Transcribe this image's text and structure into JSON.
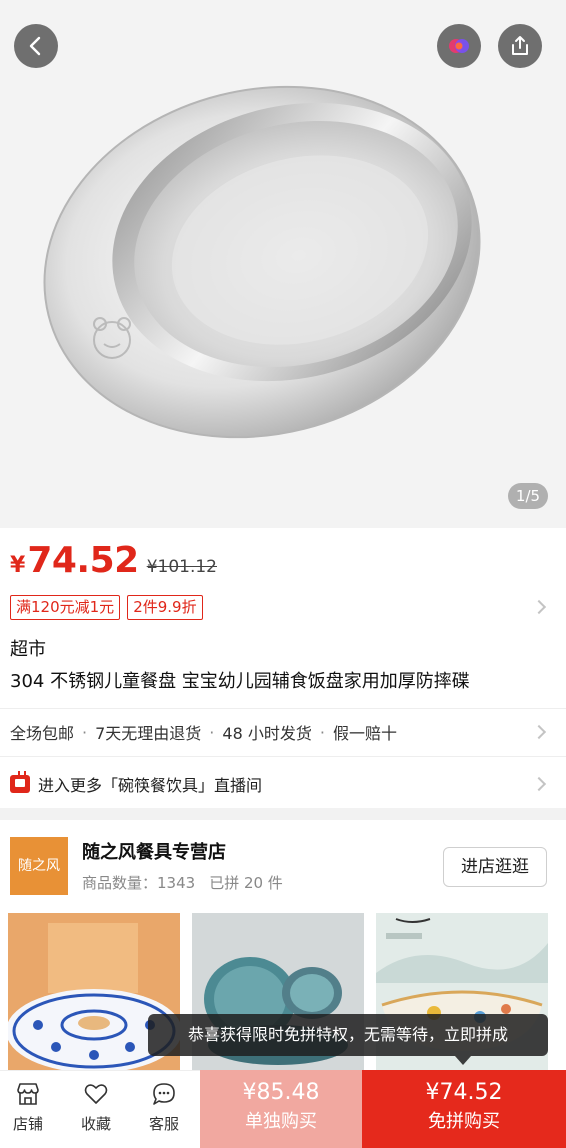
{
  "hero": {
    "page_indicator": "1/5",
    "icons": [
      "back-arrow-icon",
      "assistant-icon",
      "share-icon"
    ]
  },
  "price": {
    "currency": "¥",
    "current": "74.52",
    "original": "¥101.12",
    "color": "#e0271a"
  },
  "promos": [
    "满120元减1元",
    "2件9.9折"
  ],
  "product": {
    "market_label": "超市",
    "title": "304 不锈钢儿童餐盘 宝宝幼儿园辅食饭盘家用加厚防摔碟"
  },
  "services": [
    "全场包邮",
    "7天无理由退货",
    "48 小时发货",
    "假一赔十"
  ],
  "live": {
    "text": "进入更多「碗筷餐饮具」直播间"
  },
  "store": {
    "logo_text": "随之风",
    "name": "随之风餐具专营店",
    "product_count": "商品数量：1343",
    "sold": "已拼 20 件",
    "enter_label": "进店逛逛"
  },
  "toast": {
    "text": "恭喜获得限时免拼特权，无需等待，立即拼成"
  },
  "bottom_nav": {
    "store_label": "店铺",
    "fav_label": "收藏",
    "service_label": "客服"
  },
  "buy": {
    "single_price": "¥85.48",
    "single_label": "单独购买",
    "group_price": "¥74.52",
    "group_label": "免拼购买",
    "single_color": "#f1a8a0",
    "group_color": "#e5291c"
  }
}
